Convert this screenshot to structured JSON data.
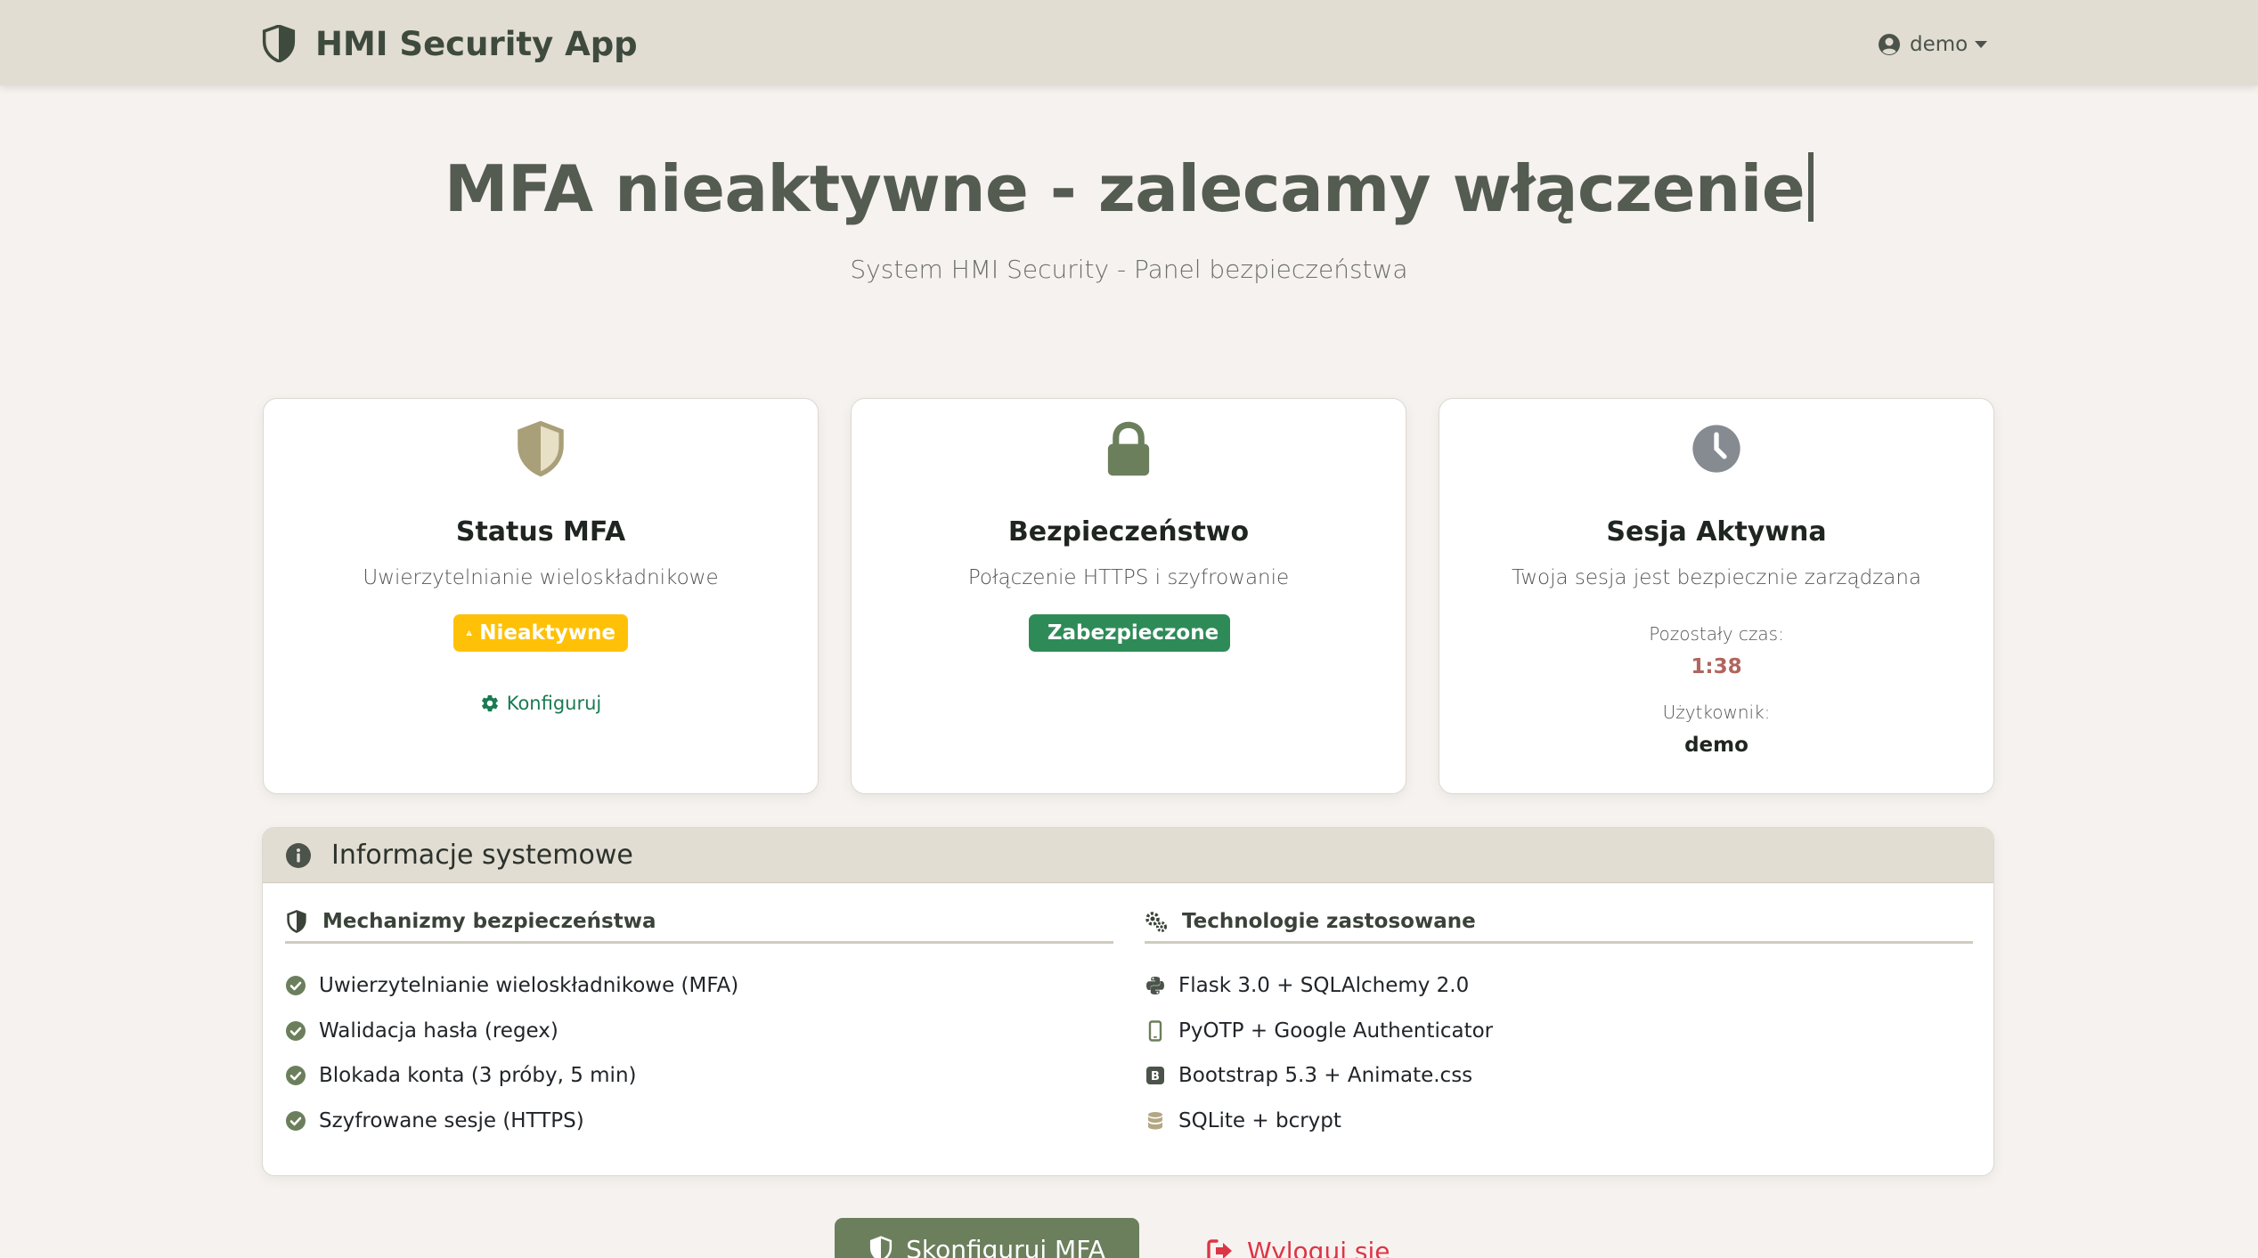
{
  "navbar": {
    "brand": "HMI Security App",
    "brand_icon": "shield-half-icon",
    "user": "demo",
    "user_icon": "user-circle-icon"
  },
  "hero": {
    "title": "MFA nieaktywne - zalecamy włączenie",
    "subtitle": "System HMI Security - Panel bezpieczeństwa"
  },
  "cards": {
    "mfa": {
      "icon": "shield-half-icon",
      "title": "Status MFA",
      "description": "Uwierzytelnianie wieloskładnikowe",
      "badge": "Nieaktywne",
      "badge_icon": "warning-triangle-icon",
      "badge_color": "#ffc107",
      "link": "Konfiguruj",
      "link_icon": "gear-icon"
    },
    "security": {
      "icon": "lock-icon",
      "title": "Bezpieczeństwo",
      "description": "Połączenie HTTPS i szyfrowanie",
      "badge": "Zabezpieczone",
      "badge_icon": "check-icon",
      "badge_color": "#2e8b57"
    },
    "session": {
      "icon": "clock-icon",
      "title": "Sesja Aktywna",
      "description": "Twoja sesja jest bezpiecznie zarządzana",
      "time_label": "Pozostały czas:",
      "time_value": "1:38",
      "user_label": "Użytkownik:",
      "user_value": "demo"
    }
  },
  "info": {
    "title": "Informacje systemowe",
    "title_icon": "info-circle-icon",
    "mechanisms": {
      "title": "Mechanizmy bezpieczeństwa",
      "items": [
        "Uwierzytelnianie wieloskładnikowe (MFA)",
        "Walidacja hasła (regex)",
        "Blokada konta (3 próby, 5 min)",
        "Szyfrowane sesje (HTTPS)"
      ]
    },
    "technologies": {
      "title": "Technologie zastosowane",
      "items": [
        "Flask 3.0 + SQLAlchemy 2.0",
        "PyOTP + Google Authenticator",
        "Bootstrap 5.3 + Animate.css",
        "SQLite + bcrypt"
      ]
    }
  },
  "actions": {
    "configure_mfa": "Skonfiguruj MFA",
    "logout": "Wyloguj się"
  },
  "colors": {
    "accent": "#6b7f5c",
    "navbar": "#e1ddd2",
    "danger": "#dc3545"
  }
}
